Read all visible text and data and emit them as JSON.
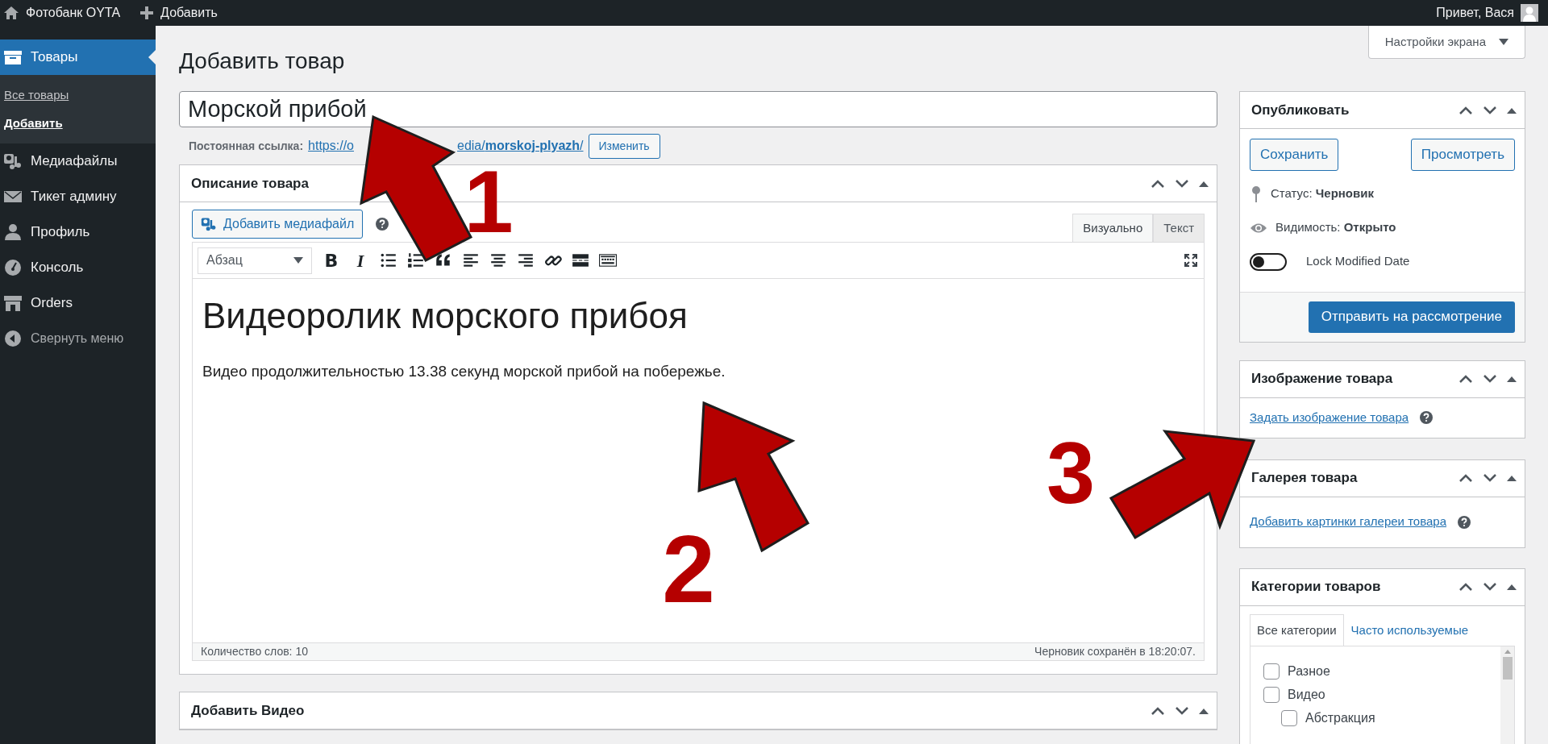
{
  "admin_bar": {
    "site_name": "Фотобанк OYTA",
    "new_label": "Добавить",
    "greeting": "Привет, Вася"
  },
  "sidebar": {
    "items": [
      {
        "label": "Товары",
        "kind": "archive",
        "selected": true,
        "expanded": true,
        "children": [
          {
            "label": "Все товары",
            "selected": false
          },
          {
            "label": "Добавить",
            "selected": true
          }
        ]
      },
      {
        "label": "Медиафайлы",
        "kind": "media",
        "selected": false
      },
      {
        "label": "Тикет админу",
        "kind": "mail",
        "selected": false
      },
      {
        "label": "Профиль",
        "kind": "user",
        "selected": false
      },
      {
        "label": "Консоль",
        "kind": "gauge",
        "selected": false
      },
      {
        "label": "Orders",
        "kind": "store",
        "selected": false
      },
      {
        "label": "Свернуть меню",
        "kind": "collapse",
        "selected": false
      }
    ]
  },
  "screen_options": "Настройки экрана",
  "page_title": "Добавить товар",
  "title_field": {
    "value": "Морской прибой"
  },
  "permalink": {
    "label": "Постоянная ссылка:",
    "url_start": "https://o",
    "url_end": "edia/**morskoj-plyazh**/",
    "edit_button": "Изменить"
  },
  "editor": {
    "title": "Описание товара",
    "add_media": "Добавить медиафайл",
    "tabs": [
      {
        "label": "Визуально",
        "selected": true
      },
      {
        "label": "Текст",
        "selected": false
      }
    ],
    "format": "Абзац",
    "toolbar": [
      {
        "kind": "bold",
        "label": "B"
      },
      {
        "kind": "italic",
        "label": "I"
      },
      {
        "kind": "bullet-list"
      },
      {
        "kind": "numbered-list"
      },
      {
        "kind": "quote"
      },
      {
        "kind": "align-left"
      },
      {
        "kind": "align-center"
      },
      {
        "kind": "align-right"
      },
      {
        "kind": "link"
      },
      {
        "kind": "more"
      },
      {
        "kind": "toolbar-toggle"
      }
    ],
    "heading": "Видеоролик морского прибоя",
    "paragraph": "Видео продолжительностью 13.38 секунд морской прибой на побережье.",
    "word_count": "Количество слов: 10",
    "saved": "Черновик сохранён в 18:20:07."
  },
  "video_box": {
    "title": "Добавить Видео"
  },
  "publish": {
    "title": "Опубликовать",
    "save": "Сохранить",
    "preview": "Просмотреть",
    "status": "Статус: **Черновик**",
    "visibility": "Видимость: **Открыто**",
    "lock": {
      "label": "Lock Modified Date",
      "on": false
    },
    "submit": "Отправить на рассмотрение"
  },
  "product_image": {
    "title": "Изображение товара",
    "link": "Задать изображение товара"
  },
  "gallery": {
    "title": "Галерея товара",
    "link": "Добавить картинки галереи товара"
  },
  "categories": {
    "title": "Категории товаров",
    "tabs": [
      {
        "label": "Все категории",
        "selected": true
      },
      {
        "label": "Часто используемые",
        "selected": false
      }
    ],
    "items": [
      {
        "label": "Разное",
        "checked": false
      },
      {
        "label": "Видео",
        "checked": false,
        "children": [
          {
            "label": "Абстракция",
            "checked": false
          }
        ]
      }
    ]
  },
  "annotations": [
    {
      "label": "1"
    },
    {
      "label": "2"
    },
    {
      "label": "3"
    }
  ]
}
